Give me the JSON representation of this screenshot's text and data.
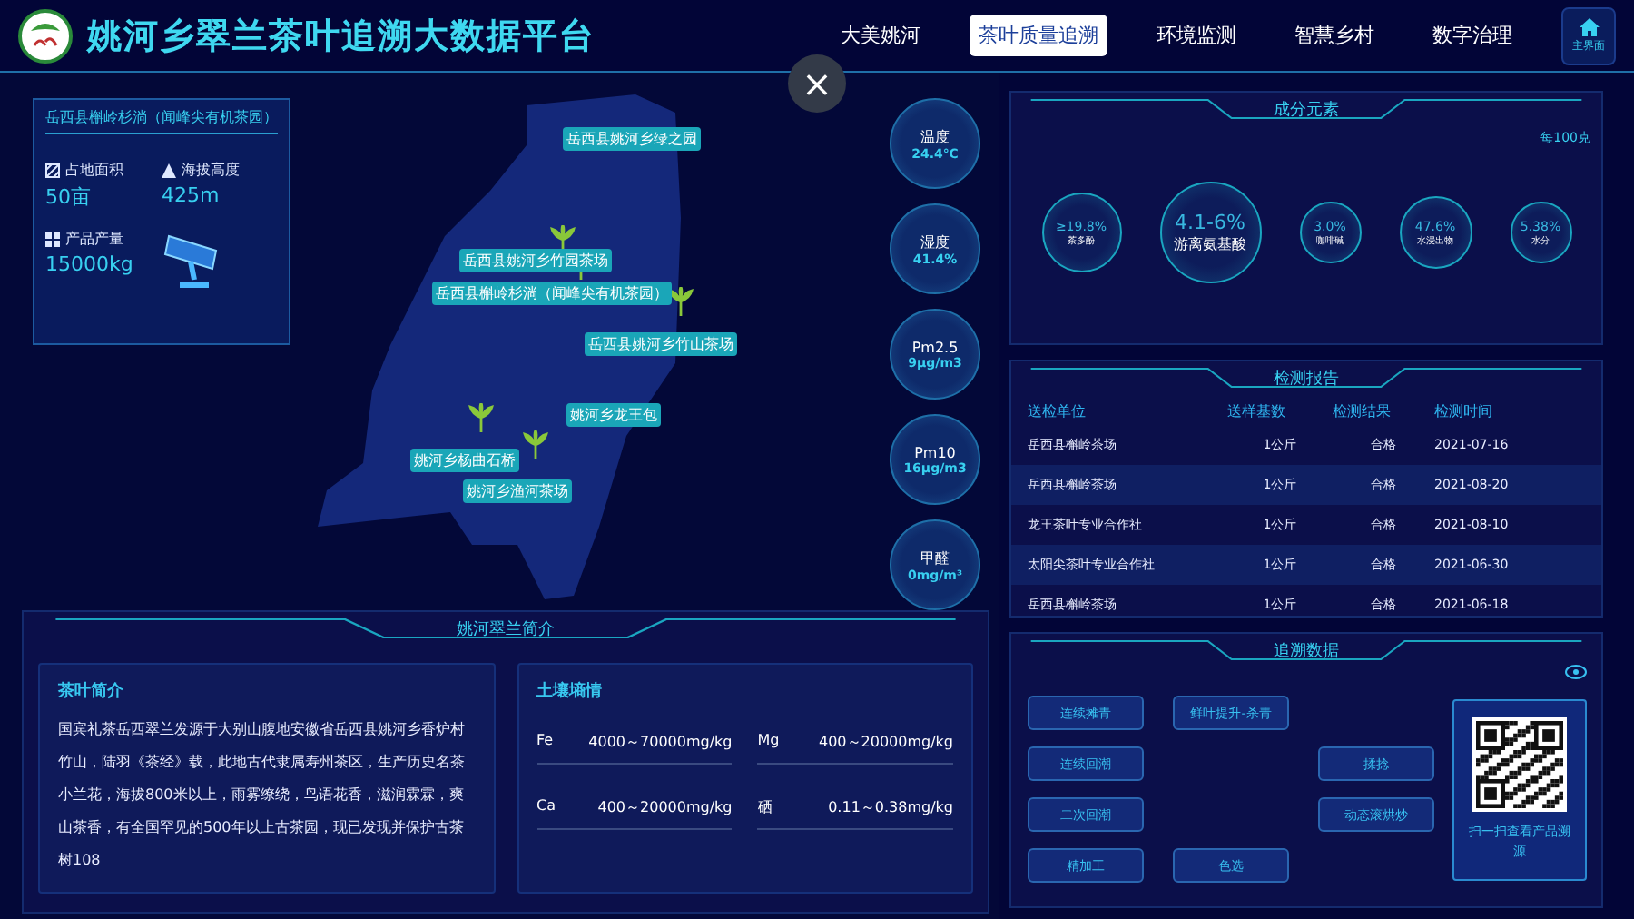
{
  "header": {
    "title": "姚河乡翠兰茶叶追溯大数据平台",
    "tabs": [
      {
        "label": "大美姚河",
        "selected": false
      },
      {
        "label": "茶叶质量追溯",
        "selected": true
      },
      {
        "label": "环境监测",
        "selected": false
      },
      {
        "label": "智慧乡村",
        "selected": false
      },
      {
        "label": "数字治理",
        "selected": false
      }
    ],
    "home_button": "主界面"
  },
  "close_button": "×",
  "map": {
    "site_card": {
      "title": "岳西县槲岭杉淌（闻峰尖有机茶园）",
      "stats": [
        {
          "kind": "area",
          "label": "占地面积",
          "value": "50亩"
        },
        {
          "kind": "altitude",
          "label": "海拔高度",
          "value": "425m"
        },
        {
          "kind": "output",
          "label": "产品产量",
          "value": "15000kg"
        }
      ]
    },
    "pins": [
      {
        "label": "岳西县姚河乡绿之园"
      },
      {
        "label": "岳西县姚河乡竹园茶场"
      },
      {
        "label": "岳西县槲岭杉淌（闻峰尖有机茶园）"
      },
      {
        "label": "岳西县姚河乡竹山茶场"
      },
      {
        "label": "姚河乡龙王包"
      },
      {
        "label": "姚河乡杨曲石桥"
      },
      {
        "label": "姚河乡渔河茶场"
      }
    ],
    "sensors": [
      {
        "label": "温度",
        "value": "24.4℃"
      },
      {
        "label": "湿度",
        "value": "41.4%"
      },
      {
        "label": "Pm2.5",
        "value": "9μg/m3"
      },
      {
        "label": "Pm10",
        "value": "16μg/m3"
      },
      {
        "label": "甲醛",
        "value": "0mg/m³"
      }
    ]
  },
  "intro": {
    "title": "姚河翠兰简介",
    "tea": {
      "heading": "茶叶简介",
      "text": "国宾礼茶岳西翠兰发源于大别山腹地安徽省岳西县姚河乡香炉村竹山，陆羽《茶经》载，此地古代隶属寿州茶区，生产历史名茶小兰花，海拔800米以上，雨雾缭绕，鸟语花香，滋润霖霖，爽山茶香，有全国罕见的500年以上古茶园，现已发现并保护古茶树108"
    },
    "soil": {
      "heading": "土壤墒情",
      "items": [
        {
          "element": "Fe",
          "range": "4000～70000mg/kg"
        },
        {
          "element": "Mg",
          "range": "400～20000mg/kg"
        },
        {
          "element": "Ca",
          "range": "400～20000mg/kg"
        },
        {
          "element": "硒",
          "range": "0.11～0.38mg/kg"
        }
      ]
    }
  },
  "composition": {
    "title": "成分元素",
    "unit": "每100克",
    "items": [
      {
        "value": "≥19.8%",
        "name": "茶多酚"
      },
      {
        "value": "4.1-6%",
        "name": "游离氨基酸"
      },
      {
        "value": "3.0%",
        "name": "咖啡碱"
      },
      {
        "value": "47.6%",
        "name": "水浸出物"
      },
      {
        "value": "5.38%",
        "name": "水分"
      }
    ]
  },
  "report": {
    "title": "检测报告",
    "columns": [
      "送检单位",
      "送样基数",
      "检测结果",
      "检测时间"
    ],
    "rows": [
      [
        "岳西县槲岭茶场",
        "1公斤",
        "合格",
        "2021-07-16"
      ],
      [
        "岳西县槲岭茶场",
        "1公斤",
        "合格",
        "2021-08-20"
      ],
      [
        "龙王茶叶专业合作社",
        "1公斤",
        "合格",
        "2021-08-10"
      ],
      [
        "太阳尖茶叶专业合作社",
        "1公斤",
        "合格",
        "2021-06-30"
      ],
      [
        "岳西县槲岭茶场",
        "1公斤",
        "合格",
        "2021-06-18"
      ]
    ]
  },
  "trace": {
    "title": "追溯数据",
    "steps": [
      "连续摊青",
      "鲜叶提升-杀青",
      "连续回潮",
      "揉捻",
      "二次回潮",
      "动态滚烘炒",
      "精加工",
      "色选"
    ],
    "qr_caption": "扫一扫查看产品溯源"
  }
}
